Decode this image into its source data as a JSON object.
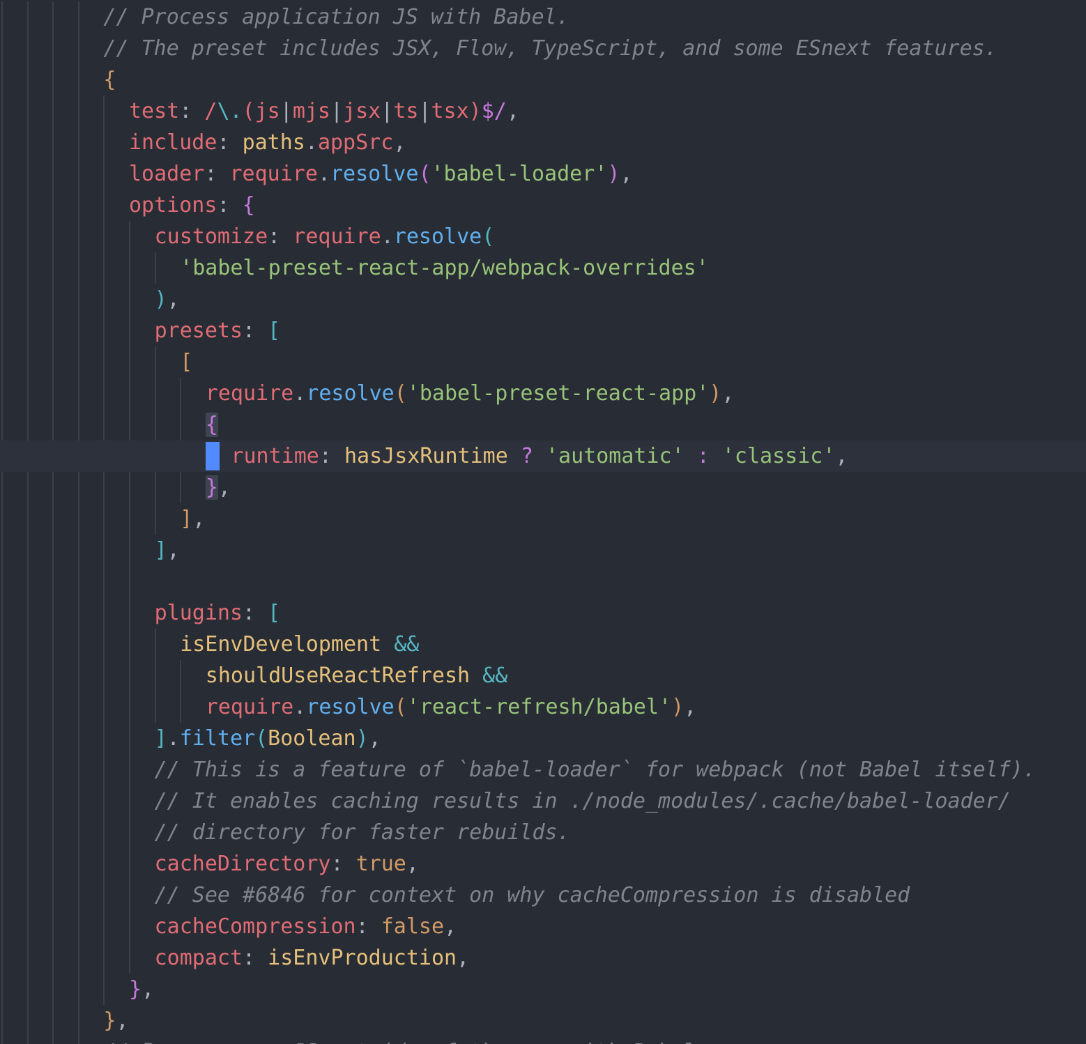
{
  "editor": {
    "language": "javascript",
    "cursor": {
      "line_index": 14,
      "column": 0
    },
    "colors": {
      "background": "#282c34",
      "active_line": "#2c313c",
      "cursor": "#528bff",
      "comment": "#7f848e",
      "property": "#e06c75",
      "string": "#98c379",
      "function": "#61afef",
      "variable": "#e5c07b",
      "constant": "#d19a66",
      "operator": "#56b6c2"
    },
    "lines": [
      {
        "indent": 4,
        "tokens": [
          {
            "t": "// Process application JS with Babel.",
            "c": "comment"
          }
        ]
      },
      {
        "indent": 4,
        "tokens": [
          {
            "t": "// The preset includes JSX, Flow, TypeScript, and some ESnext features.",
            "c": "comment"
          }
        ]
      },
      {
        "indent": 4,
        "tokens": [
          {
            "t": "{",
            "c": "br1"
          }
        ]
      },
      {
        "indent": 5,
        "tokens": [
          {
            "t": "test",
            "c": "key"
          },
          {
            "t": ": ",
            "c": "punc"
          },
          {
            "t": "/",
            "c": "key"
          },
          {
            "t": "\\.",
            "c": "regex"
          },
          {
            "t": "(js",
            "c": "key"
          },
          {
            "t": "|",
            "c": "punc"
          },
          {
            "t": "mjs",
            "c": "key"
          },
          {
            "t": "|",
            "c": "punc"
          },
          {
            "t": "jsx",
            "c": "key"
          },
          {
            "t": "|",
            "c": "punc"
          },
          {
            "t": "ts",
            "c": "key"
          },
          {
            "t": "|",
            "c": "punc"
          },
          {
            "t": "tsx)",
            "c": "key"
          },
          {
            "t": "$/",
            "c": "br2"
          },
          {
            "t": ",",
            "c": "punc"
          }
        ]
      },
      {
        "indent": 5,
        "tokens": [
          {
            "t": "include",
            "c": "key"
          },
          {
            "t": ": ",
            "c": "punc"
          },
          {
            "t": "paths",
            "c": "var"
          },
          {
            "t": ".",
            "c": "punc"
          },
          {
            "t": "appSrc",
            "c": "key"
          },
          {
            "t": ",",
            "c": "punc"
          }
        ]
      },
      {
        "indent": 5,
        "tokens": [
          {
            "t": "loader",
            "c": "key"
          },
          {
            "t": ": ",
            "c": "punc"
          },
          {
            "t": "require",
            "c": "key"
          },
          {
            "t": ".",
            "c": "punc"
          },
          {
            "t": "resolve",
            "c": "fn"
          },
          {
            "t": "(",
            "c": "br2"
          },
          {
            "t": "'babel-loader'",
            "c": "str"
          },
          {
            "t": ")",
            "c": "br2"
          },
          {
            "t": ",",
            "c": "punc"
          }
        ]
      },
      {
        "indent": 5,
        "tokens": [
          {
            "t": "options",
            "c": "key"
          },
          {
            "t": ": ",
            "c": "punc"
          },
          {
            "t": "{",
            "c": "br2"
          }
        ]
      },
      {
        "indent": 6,
        "tokens": [
          {
            "t": "customize",
            "c": "key"
          },
          {
            "t": ": ",
            "c": "punc"
          },
          {
            "t": "require",
            "c": "key"
          },
          {
            "t": ".",
            "c": "punc"
          },
          {
            "t": "resolve",
            "c": "fn"
          },
          {
            "t": "(",
            "c": "br3"
          }
        ]
      },
      {
        "indent": 7,
        "tokens": [
          {
            "t": "'babel-preset-react-app/webpack-overrides'",
            "c": "str"
          }
        ]
      },
      {
        "indent": 6,
        "tokens": [
          {
            "t": ")",
            "c": "br3"
          },
          {
            "t": ",",
            "c": "punc"
          }
        ]
      },
      {
        "indent": 6,
        "tokens": [
          {
            "t": "presets",
            "c": "key"
          },
          {
            "t": ": ",
            "c": "punc"
          },
          {
            "t": "[",
            "c": "br3"
          }
        ]
      },
      {
        "indent": 7,
        "tokens": [
          {
            "t": "[",
            "c": "br1"
          }
        ]
      },
      {
        "indent": 8,
        "tokens": [
          {
            "t": "require",
            "c": "key"
          },
          {
            "t": ".",
            "c": "punc"
          },
          {
            "t": "resolve",
            "c": "fn"
          },
          {
            "t": "(",
            "c": "br1"
          },
          {
            "t": "'babel-preset-react-app'",
            "c": "str"
          },
          {
            "t": ")",
            "c": "br1"
          },
          {
            "t": ",",
            "c": "punc"
          }
        ]
      },
      {
        "indent": 8,
        "tokens": [
          {
            "t": "{",
            "c": "br2",
            "hl": true
          }
        ]
      },
      {
        "indent": 9,
        "tokens": [
          {
            "t": "runtime",
            "c": "key"
          },
          {
            "t": ": ",
            "c": "punc"
          },
          {
            "t": "hasJsxRuntime",
            "c": "var"
          },
          {
            "t": " ? ",
            "c": "br2"
          },
          {
            "t": "'automatic'",
            "c": "str"
          },
          {
            "t": " : ",
            "c": "br2"
          },
          {
            "t": "'classic'",
            "c": "str"
          },
          {
            "t": ",",
            "c": "punc"
          }
        ]
      },
      {
        "indent": 8,
        "tokens": [
          {
            "t": "}",
            "c": "br2",
            "hl": true
          },
          {
            "t": ",",
            "c": "punc"
          }
        ]
      },
      {
        "indent": 7,
        "tokens": [
          {
            "t": "]",
            "c": "br1"
          },
          {
            "t": ",",
            "c": "punc"
          }
        ]
      },
      {
        "indent": 6,
        "tokens": [
          {
            "t": "]",
            "c": "br3"
          },
          {
            "t": ",",
            "c": "punc"
          }
        ]
      },
      {
        "indent": 6,
        "tokens": []
      },
      {
        "indent": 6,
        "tokens": [
          {
            "t": "plugins",
            "c": "key"
          },
          {
            "t": ": ",
            "c": "punc"
          },
          {
            "t": "[",
            "c": "br3"
          }
        ]
      },
      {
        "indent": 7,
        "tokens": [
          {
            "t": "isEnvDevelopment",
            "c": "var"
          },
          {
            "t": " && ",
            "c": "op"
          }
        ]
      },
      {
        "indent": 8,
        "tokens": [
          {
            "t": "shouldUseReactRefresh",
            "c": "var"
          },
          {
            "t": " && ",
            "c": "op"
          }
        ]
      },
      {
        "indent": 8,
        "tokens": [
          {
            "t": "require",
            "c": "key"
          },
          {
            "t": ".",
            "c": "punc"
          },
          {
            "t": "resolve",
            "c": "fn"
          },
          {
            "t": "(",
            "c": "br1"
          },
          {
            "t": "'react-refresh/babel'",
            "c": "str"
          },
          {
            "t": ")",
            "c": "br1"
          },
          {
            "t": ",",
            "c": "punc"
          }
        ]
      },
      {
        "indent": 6,
        "tokens": [
          {
            "t": "]",
            "c": "br3"
          },
          {
            "t": ".",
            "c": "punc"
          },
          {
            "t": "filter",
            "c": "fn"
          },
          {
            "t": "(",
            "c": "br3"
          },
          {
            "t": "Boolean",
            "c": "var"
          },
          {
            "t": ")",
            "c": "br3"
          },
          {
            "t": ",",
            "c": "punc"
          }
        ]
      },
      {
        "indent": 6,
        "tokens": [
          {
            "t": "// This is a feature of `babel-loader` for webpack (not Babel itself).",
            "c": "comment"
          }
        ]
      },
      {
        "indent": 6,
        "tokens": [
          {
            "t": "// It enables caching results in ./node_modules/.cache/babel-loader/",
            "c": "comment"
          }
        ]
      },
      {
        "indent": 6,
        "tokens": [
          {
            "t": "// directory for faster rebuilds.",
            "c": "comment"
          }
        ]
      },
      {
        "indent": 6,
        "tokens": [
          {
            "t": "cacheDirectory",
            "c": "key"
          },
          {
            "t": ": ",
            "c": "punc"
          },
          {
            "t": "true",
            "c": "const"
          },
          {
            "t": ",",
            "c": "punc"
          }
        ]
      },
      {
        "indent": 6,
        "tokens": [
          {
            "t": "// See #6846 for context on why cacheCompression is disabled",
            "c": "comment"
          }
        ]
      },
      {
        "indent": 6,
        "tokens": [
          {
            "t": "cacheCompression",
            "c": "key"
          },
          {
            "t": ": ",
            "c": "punc"
          },
          {
            "t": "false",
            "c": "const"
          },
          {
            "t": ",",
            "c": "punc"
          }
        ]
      },
      {
        "indent": 6,
        "tokens": [
          {
            "t": "compact",
            "c": "key"
          },
          {
            "t": ": ",
            "c": "punc"
          },
          {
            "t": "isEnvProduction",
            "c": "var"
          },
          {
            "t": ",",
            "c": "punc"
          }
        ]
      },
      {
        "indent": 5,
        "tokens": [
          {
            "t": "}",
            "c": "br2"
          },
          {
            "t": ",",
            "c": "punc"
          }
        ]
      },
      {
        "indent": 4,
        "tokens": [
          {
            "t": "}",
            "c": "br1"
          },
          {
            "t": ",",
            "c": "punc"
          }
        ]
      },
      {
        "indent": 4,
        "tokens": [
          {
            "t": "// Process any JS outside of the app with Babel.",
            "c": "comment"
          }
        ]
      }
    ]
  }
}
